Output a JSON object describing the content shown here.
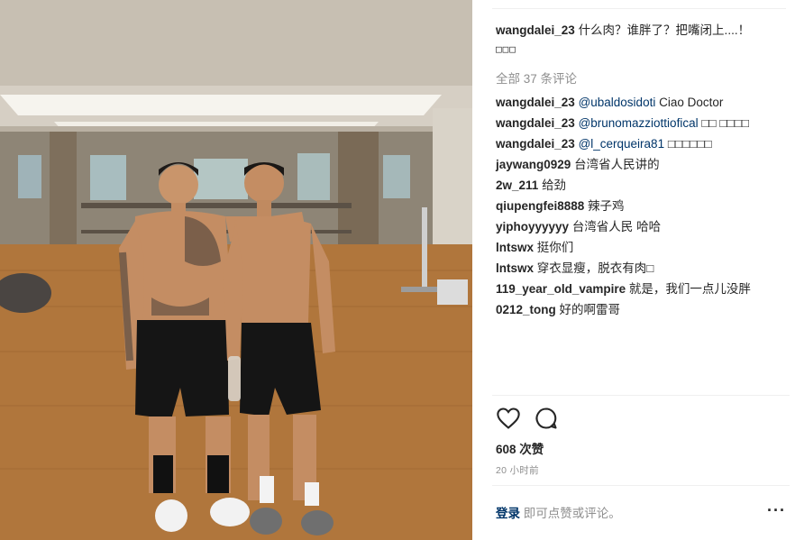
{
  "photo": {
    "description_icon": "gym-photo"
  },
  "caption": {
    "username": "wangdalei_23",
    "text": "什么肉？谁胖了？把嘴闭上....！",
    "trailing_glyphs": "□□□"
  },
  "view_all_comments": "全部 37 条评论",
  "comments": [
    {
      "username": "wangdalei_23",
      "mention": "@ubaldosidoti",
      "text": "Ciao Doctor"
    },
    {
      "username": "wangdalei_23",
      "mention": "@brunomazziottiofical",
      "text": "□□ □□□□"
    },
    {
      "username": "wangdalei_23",
      "mention": "@l_cerqueira81",
      "text": "□□□□□□"
    },
    {
      "username": "jaywang0929",
      "mention": "",
      "text": "台湾省人民讲的"
    },
    {
      "username": "2w_211",
      "mention": "",
      "text": "给劲"
    },
    {
      "username": "qiupengfei8888",
      "mention": "",
      "text": "辣子鸡"
    },
    {
      "username": "yiphoyyyyyy",
      "mention": "",
      "text": "台湾省人民 哈哈"
    },
    {
      "username": "lntswx",
      "mention": "",
      "text": "挺你们"
    },
    {
      "username": "lntswx",
      "mention": "",
      "text": "穿衣显瘦，脱衣有肉□"
    },
    {
      "username": "119_year_old_vampire",
      "mention": "",
      "text": "就是，我们一点儿没胖"
    },
    {
      "username": "0212_tong",
      "mention": "",
      "text": "好的啊雷哥"
    }
  ],
  "actions": {
    "like_icon": "heart-icon",
    "comment_icon": "comment-bubble-icon"
  },
  "likes": "608 次赞",
  "timestamp": "20 小时前",
  "login": {
    "link": "登录",
    "text": "即可点赞或评论。"
  },
  "more_label": "···",
  "colors": {
    "text": "#262626",
    "muted": "#8e8e8e",
    "link": "#003569",
    "divider": "#efefef"
  }
}
